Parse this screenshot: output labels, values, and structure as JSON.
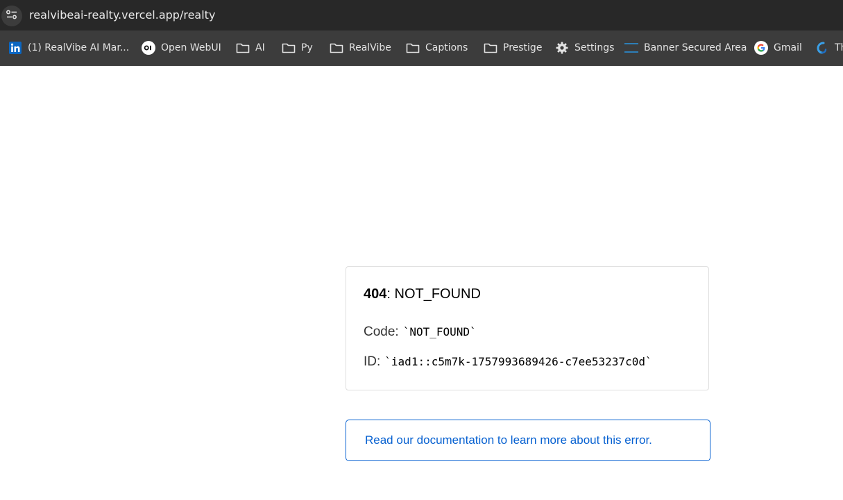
{
  "browser": {
    "url": "realvibeai-realty.vercel.app/realty",
    "bookmarks": [
      {
        "label": "(1) RealVibe AI Mar...",
        "icon": "linkedin-icon"
      },
      {
        "label": "Open WebUI",
        "icon": "openwebui-icon"
      },
      {
        "label": "AI",
        "icon": "folder-icon"
      },
      {
        "label": "Py",
        "icon": "folder-icon"
      },
      {
        "label": "RealVibe",
        "icon": "folder-icon"
      },
      {
        "label": "Captions",
        "icon": "folder-icon"
      },
      {
        "label": "Prestige",
        "icon": "folder-icon"
      },
      {
        "label": "Settings",
        "icon": "gear-icon"
      },
      {
        "label": "Banner Secured Area",
        "icon": "banner-icon"
      },
      {
        "label": "Gmail",
        "icon": "google-icon"
      },
      {
        "label": "Th",
        "icon": "blue-swirl-icon"
      }
    ]
  },
  "error": {
    "status": "404",
    "separator": ": ",
    "message": "NOT_FOUND",
    "code_label": "Code:",
    "code_value": "`NOT_FOUND`",
    "id_label": "ID:",
    "id_value": "`iad1::c5m7k-1757993689426-c7ee53237c0d`"
  },
  "docs": {
    "link_text": "Read our documentation to learn more about this error."
  },
  "colors": {
    "link": "#0761d1",
    "chrome_dark": "#282828",
    "chrome_bar": "#3c3c3c"
  }
}
